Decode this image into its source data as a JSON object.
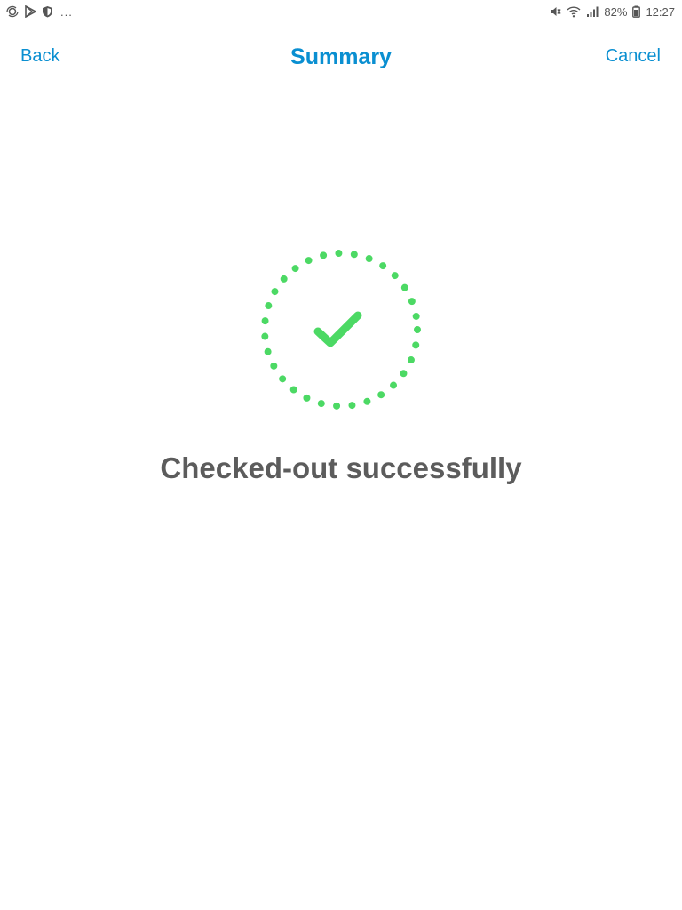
{
  "status_bar": {
    "left_icons": [
      "sync-icon",
      "play-store-icon",
      "shield-icon"
    ],
    "more_label": "...",
    "right_icons": [
      "mute-icon",
      "wifi-icon",
      "signal-icon",
      "battery-icon"
    ],
    "battery": "82%",
    "time": "12:27"
  },
  "header": {
    "back_label": "Back",
    "title": "Summary",
    "cancel_label": "Cancel"
  },
  "success": {
    "icon": "check-circle-icon",
    "message": "Checked-out successfully"
  },
  "colors": {
    "accent": "#0a8fd1",
    "success": "#4cd964",
    "message_text": "#5c5c5c"
  }
}
